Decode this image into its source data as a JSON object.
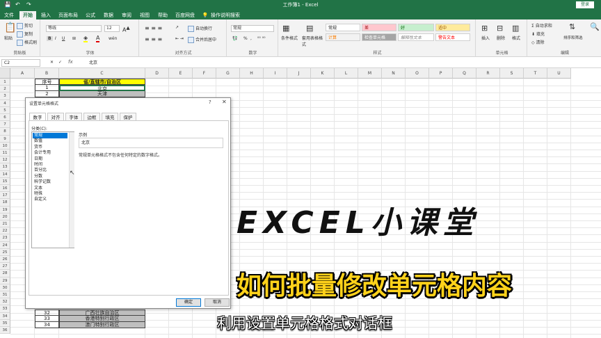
{
  "titlebar": {
    "title": "工作簿1 - Excel",
    "login": "登录"
  },
  "tabs": [
    "文件",
    "开始",
    "插入",
    "页面布局",
    "公式",
    "数据",
    "审阅",
    "视图",
    "帮助",
    "百度网盘",
    "操作说明搜索"
  ],
  "ribbon": {
    "clipboard": {
      "paste": "粘贴",
      "cut": "剪切",
      "copy": "复制",
      "format_painter": "格式刷",
      "label": "剪贴板"
    },
    "font": {
      "name": "等线",
      "size": "12",
      "bold": "B",
      "italic": "I",
      "underline": "U",
      "label": "字体",
      "wen": "wén"
    },
    "align": {
      "wrap": "自动换行",
      "merge": "合并后居中",
      "label": "对齐方式"
    },
    "number": {
      "format": "常规",
      "pct": "%",
      "comma": ",",
      "label": "数字"
    },
    "styles": {
      "cond": "条件格式",
      "table": "套用表格格式",
      "normal": "常规",
      "bad": "差",
      "good": "好",
      "neutral": "适中",
      "calc": "计算",
      "check": "检查单元格",
      "explain": "解释性文本",
      "warn": "警告文本",
      "label": "样式"
    },
    "cells": {
      "insert": "插入",
      "delete": "删除",
      "format": "格式",
      "label": "单元格"
    },
    "edit": {
      "autosum": "自动求和",
      "fill": "填充",
      "clear": "清除",
      "sort": "排序和筛选",
      "find": "查找和选择",
      "label": "编辑"
    }
  },
  "formula_bar": {
    "name_box": "C2",
    "fx": "fx",
    "value": "北京",
    "cancel": "✕",
    "enter": "✓"
  },
  "columns": [
    "A",
    "B",
    "C",
    "D",
    "E",
    "F",
    "G",
    "H",
    "I",
    "J",
    "K",
    "L",
    "M",
    "N",
    "O",
    "P",
    "Q",
    "R",
    "S",
    "T",
    "U"
  ],
  "rows": [
    "1",
    "2",
    "3",
    "4",
    "5",
    "6",
    "7",
    "8",
    "9",
    "10",
    "11",
    "12",
    "13",
    "14",
    "15",
    "16",
    "17",
    "18",
    "19",
    "20",
    "21",
    "22",
    "23",
    "24",
    "25",
    "26",
    "27",
    "28",
    "29",
    "30",
    "31",
    "32",
    "33",
    "34",
    "35",
    "36"
  ],
  "table": {
    "header": [
      "序号",
      "省/直辖市/自治区"
    ],
    "top_rows": [
      [
        "1",
        "北京"
      ],
      [
        "2",
        "天津"
      ]
    ],
    "bottom_rows": [
      [
        "32",
        "广西壮族自治区"
      ],
      [
        "33",
        "香港特别行政区"
      ],
      [
        "34",
        "澳门特别行政区"
      ]
    ]
  },
  "dialog": {
    "title": "设置单元格格式",
    "help": "?",
    "close": "✕",
    "tabs": [
      "数字",
      "对齐",
      "字体",
      "边框",
      "填充",
      "保护"
    ],
    "category_label": "分类(C):",
    "categories": [
      "常规",
      "数值",
      "货币",
      "会计专用",
      "日期",
      "时间",
      "百分比",
      "分数",
      "科学记数",
      "文本",
      "特殊",
      "自定义"
    ],
    "sample_label": "示例",
    "sample_value": "北京",
    "description": "常规单元格格式不包含任何特定的数字格式。",
    "ok": "确定",
    "cancel": "取消"
  },
  "overlay": {
    "line1": "EXCEL小课堂",
    "line2": "如何批量修改单元格内容",
    "line3": "利用设置单元格格式对话框"
  },
  "colors": {
    "excel_green": "#217346",
    "header_yellow": "#ffff00",
    "overlay_yellow": "#ffd21a",
    "selection_blue": "#0078d7"
  }
}
